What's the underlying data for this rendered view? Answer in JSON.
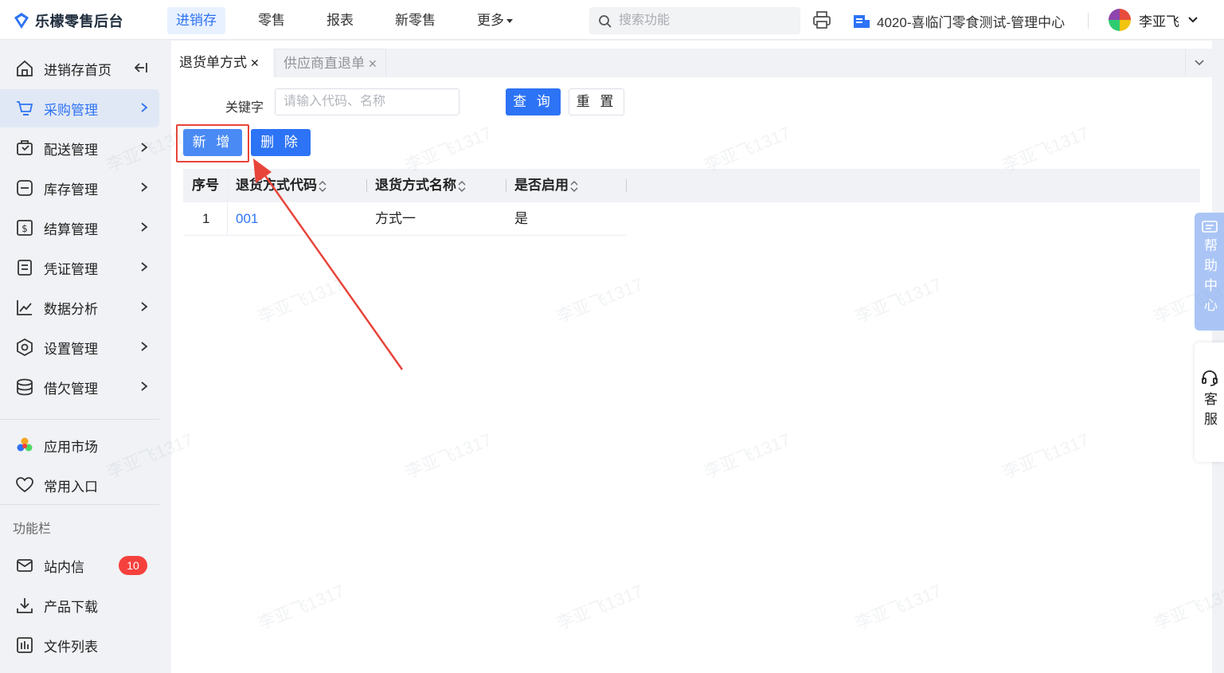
{
  "app": {
    "brand": "乐檬零售后台"
  },
  "topnav": [
    {
      "label": "进销存",
      "active": true
    },
    {
      "label": "零售"
    },
    {
      "label": "报表"
    },
    {
      "label": "新零售"
    },
    {
      "label": "更多"
    }
  ],
  "search": {
    "placeholder": "搜索功能"
  },
  "store": {
    "name": "4020-喜临门零食测试-管理中心"
  },
  "user": {
    "name": "李亚飞"
  },
  "sidebar": {
    "items": [
      {
        "label": "进销存首页",
        "icon": "home-icon"
      },
      {
        "label": "采购管理",
        "icon": "cart-icon",
        "active": true
      },
      {
        "label": "配送管理",
        "icon": "delivery-icon"
      },
      {
        "label": "库存管理",
        "icon": "inventory-icon"
      },
      {
        "label": "结算管理",
        "icon": "settlement-icon"
      },
      {
        "label": "凭证管理",
        "icon": "voucher-icon"
      },
      {
        "label": "数据分析",
        "icon": "chart-icon"
      },
      {
        "label": "设置管理",
        "icon": "settings-icon"
      },
      {
        "label": "借欠管理",
        "icon": "debt-icon"
      }
    ],
    "extra": [
      {
        "label": "应用市场",
        "icon": "app-market-icon"
      },
      {
        "label": "常用入口",
        "icon": "heart-icon"
      }
    ],
    "section_title": "功能栏",
    "tools": [
      {
        "label": "站内信",
        "icon": "mail-icon",
        "badge": "10"
      },
      {
        "label": "产品下载",
        "icon": "download-icon"
      },
      {
        "label": "文件列表",
        "icon": "file-list-icon"
      }
    ]
  },
  "tabs": [
    {
      "label": "退货单方式",
      "active": true
    },
    {
      "label": "供应商直退单"
    }
  ],
  "filter": {
    "keyword_label": "关键字",
    "keyword_placeholder": "请输入代码、名称",
    "query_label": "查 询",
    "reset_label": "重 置"
  },
  "actions": {
    "add_label": "新 增",
    "delete_label": "删 除"
  },
  "table": {
    "columns": [
      "序号",
      "退货方式代码",
      "退货方式名称",
      "是否启用"
    ],
    "rows": [
      {
        "index": "1",
        "code": "001",
        "name": "方式一",
        "enabled": "是"
      }
    ]
  },
  "float": {
    "help": "帮助中心",
    "service": "客服"
  },
  "watermark": "李亚飞1317"
}
